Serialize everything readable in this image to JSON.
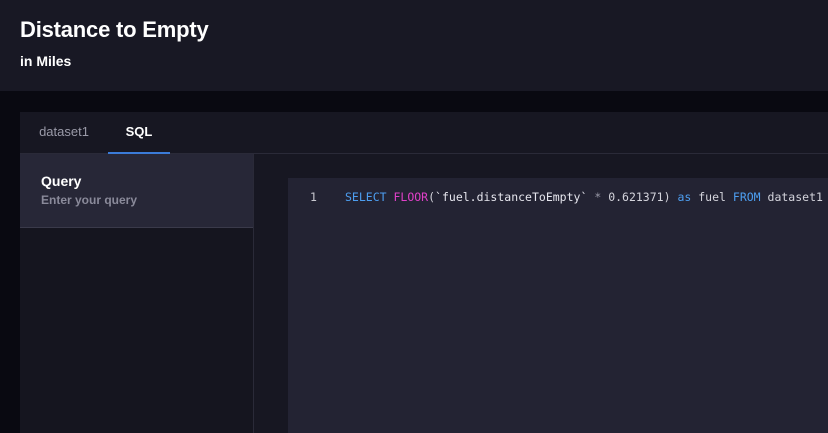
{
  "header": {
    "title": "Distance to Empty",
    "subtitle": "in Miles"
  },
  "tabs": [
    {
      "label": "dataset1",
      "active": false
    },
    {
      "label": "SQL",
      "active": true
    }
  ],
  "sidebar": {
    "query": {
      "title": "Query",
      "description": "Enter your query"
    }
  },
  "editor": {
    "line_number": "1",
    "tokens": {
      "select": "SELECT",
      "floor": "FLOOR",
      "open_paren": "(",
      "field": "`fuel.distanceToEmpty`",
      "multiply": "*",
      "factor": "0.621371",
      "close_paren": ")",
      "as": "as",
      "alias": "fuel",
      "from": "FROM",
      "table": "dataset1"
    }
  },
  "colors": {
    "accent": "#3b7bd8",
    "keyword": "#4d9ef0",
    "function": "#e040c8"
  }
}
